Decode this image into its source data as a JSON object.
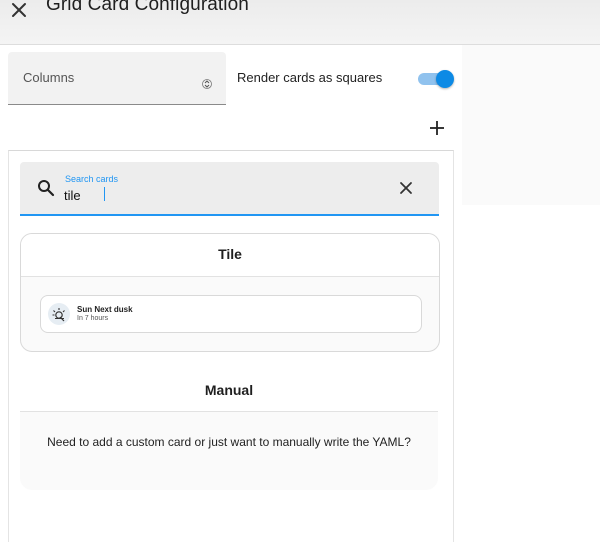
{
  "header": {
    "title": "Grid Card Configuration",
    "close_icon": "close-icon"
  },
  "settings": {
    "columns_label": "Columns",
    "render_squares_label": "Render cards as squares",
    "render_squares_enabled": true,
    "toggle_color": "#0d8ae5"
  },
  "add_tab": {
    "icon": "plus-icon",
    "accent_color": "#2196f3"
  },
  "search": {
    "label": "Search cards",
    "value": "tile",
    "search_icon": "search-icon",
    "clear_icon": "close-icon"
  },
  "results": {
    "tile_card": {
      "title": "Tile",
      "preview": {
        "icon": "sun-icon",
        "name": "Sun Next dusk",
        "state": "In 7 hours"
      }
    },
    "manual_card": {
      "title": "Manual",
      "description": "Need to add a custom card or just want to manually write the YAML?"
    }
  }
}
